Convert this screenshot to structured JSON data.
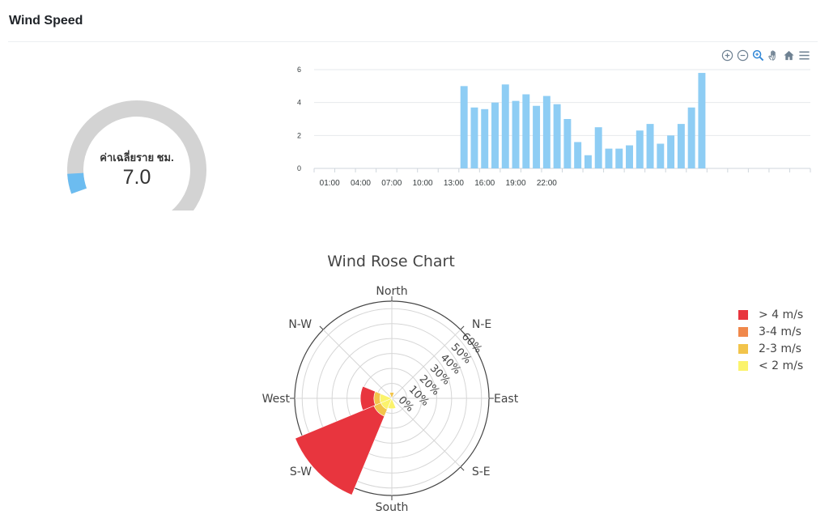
{
  "header": {
    "title": "Wind Speed"
  },
  "toolbar": {
    "icons": [
      "zoom-in-icon",
      "zoom-out-icon",
      "magnifier-icon",
      "pan-hand-icon",
      "home-icon",
      "menu-icon"
    ]
  },
  "gauge": {
    "label": "ค่าเฉลี่ยราย ชม.",
    "value_text": "7.0",
    "fill_fraction": 0.06,
    "track_color": "#d3d3d3",
    "fill_color": "#6cbcf0"
  },
  "chart_data": [
    {
      "type": "bar",
      "color": "#8ecdf4",
      "ylim": [
        0,
        6
      ],
      "yticks": [
        0,
        2,
        4,
        6
      ],
      "xtick_labels": [
        "01:00",
        "04:00",
        "07:00",
        "10:00",
        "13:00",
        "16:00",
        "19:00",
        "22:00"
      ],
      "categories": [
        "00:00",
        "01:00",
        "02:00",
        "03:00",
        "04:00",
        "05:00",
        "06:00",
        "07:00",
        "08:00",
        "09:00",
        "10:00",
        "11:00",
        "12:00",
        "13:00",
        "14:00",
        "15:00",
        "16:00",
        "17:00",
        "18:00",
        "19:00",
        "20:00",
        "21:00",
        "22:00",
        "23:00",
        "00:00",
        "01:00",
        "02:00",
        "03:00",
        "04:00",
        "05:00",
        "06:00",
        "07:00",
        "08:00",
        "09:00",
        "10:00",
        "11:00",
        "12:00",
        "13:00",
        "14:00",
        "15:00",
        "16:00",
        "17:00",
        "18:00",
        "19:00",
        "20:00",
        "21:00",
        "22:00",
        "23:00"
      ],
      "values": [
        null,
        null,
        null,
        null,
        null,
        null,
        null,
        null,
        null,
        null,
        null,
        null,
        null,
        null,
        5.0,
        3.7,
        3.6,
        4.0,
        5.1,
        4.1,
        4.5,
        3.8,
        4.4,
        3.9,
        3.0,
        1.6,
        0.8,
        2.5,
        1.2,
        1.2,
        1.4,
        2.3,
        2.7,
        1.5,
        2.0,
        2.7,
        3.7,
        5.8,
        null,
        null,
        null,
        null,
        null,
        null,
        null,
        null,
        null,
        null
      ]
    },
    {
      "type": "barpolar",
      "title": "Wind Rose Chart",
      "directions": [
        "North",
        "N-E",
        "East",
        "S-E",
        "South",
        "S-W",
        "West",
        "N-W"
      ],
      "radial_ticks": [
        "0%",
        "10%",
        "20%",
        "30%",
        "40%",
        "50%",
        "60%"
      ],
      "radial_range": [
        0,
        65
      ],
      "series": [
        {
          "name": "> 4 m/s",
          "color": "#e8353e",
          "values": [
            0,
            0,
            0,
            0,
            0,
            57,
            9,
            0
          ]
        },
        {
          "name": "3-4 m/s",
          "color": "#f0884b",
          "values": [
            0,
            0,
            0,
            0,
            0,
            0,
            0,
            0
          ]
        },
        {
          "name": "2-3 m/s",
          "color": "#f2c44b",
          "values": [
            4,
            0,
            0,
            0,
            0,
            5,
            4,
            0
          ]
        },
        {
          "name": "< 2 m/s",
          "color": "#fbf36c",
          "values": [
            0,
            0,
            0,
            0,
            7,
            8,
            8,
            0
          ]
        }
      ]
    }
  ]
}
